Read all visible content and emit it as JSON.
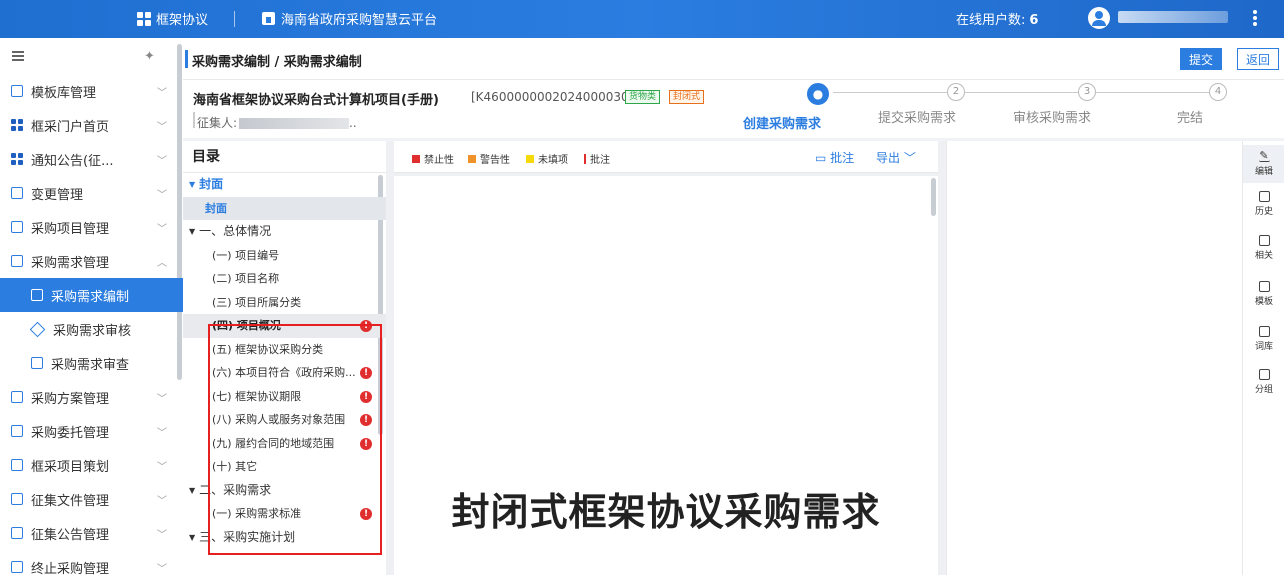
{
  "topbar": {
    "module": "框架协议",
    "platform": "海南省政府采购智慧云平台",
    "online_label": "在线用户数:",
    "online_count": "6"
  },
  "sidebar": {
    "items": [
      {
        "label": "模板库管理",
        "icon": "template-icon"
      },
      {
        "label": "框采门户首页",
        "icon": "grid-icon"
      },
      {
        "label": "通知公告(征...",
        "icon": "grid-icon"
      },
      {
        "label": "变更管理",
        "icon": "change-icon"
      },
      {
        "label": "采购项目管理",
        "icon": "folder-icon"
      },
      {
        "label": "采购需求管理",
        "icon": "document-icon"
      },
      {
        "label": "采购需求编制",
        "icon": "edit-icon"
      },
      {
        "label": "采购需求审核",
        "icon": "diamond-icon"
      },
      {
        "label": "采购需求审查",
        "icon": "review-icon"
      },
      {
        "label": "采购方案管理",
        "icon": "plan-icon"
      },
      {
        "label": "采购委托管理",
        "icon": "entrust-icon"
      },
      {
        "label": "框采项目策划",
        "icon": "folder-icon"
      },
      {
        "label": "征集文件管理",
        "icon": "file-icon"
      },
      {
        "label": "征集公告管理",
        "icon": "notice-icon"
      },
      {
        "label": "终止采购管理",
        "icon": "stop-icon"
      }
    ]
  },
  "breadcrumb": "采购需求编制 / 采购需求编制",
  "actions": {
    "submit": "提交",
    "back": "返回"
  },
  "project": {
    "title": "海南省框架协议采购台式计算机项目(手册)",
    "code": "[K4600000002024000030]",
    "tag_goods": "货物类",
    "tag_closed": "封闭式",
    "collector_label": "征集人:",
    "collector_suffix": ".."
  },
  "steps": [
    {
      "num": "",
      "label": "创建采购需求",
      "active": true
    },
    {
      "num": "2",
      "label": "提交采购需求",
      "active": false
    },
    {
      "num": "3",
      "label": "审核采购需求",
      "active": false
    },
    {
      "num": "4",
      "label": "完结",
      "active": false
    }
  ],
  "toc": {
    "heading": "目录",
    "items": [
      {
        "label": "封面"
      },
      {
        "label": "封面"
      },
      {
        "label": "一、总体情况"
      },
      {
        "label": "(一) 项目编号"
      },
      {
        "label": "(二) 项目名称"
      },
      {
        "label": "(三) 项目所属分类"
      },
      {
        "label": "(四) 项目概况"
      },
      {
        "label": "(五) 框架协议采购分类"
      },
      {
        "label": "(六) 本项目符合《政府采购..."
      },
      {
        "label": "(七) 框架协议期限"
      },
      {
        "label": "(八) 采购人或服务对象范围"
      },
      {
        "label": "(九) 履约合同的地域范围"
      },
      {
        "label": "(十) 其它"
      },
      {
        "label": "二、采购需求"
      },
      {
        "label": "(一) 采购需求标准"
      },
      {
        "label": "三、采购实施计划"
      }
    ]
  },
  "legend": {
    "prohibit": "禁止性",
    "warning": "警告性",
    "unfilled": "未填项",
    "annotation": "批注",
    "colors": {
      "prohibit": "#e02d2d",
      "warning": "#f0922b",
      "unfilled": "#f5d90a"
    }
  },
  "doc_actions": {
    "annotate": "批注",
    "export": "导出"
  },
  "document": {
    "title": "封闭式框架协议采购需求"
  },
  "tools": [
    {
      "label": "编辑",
      "icon": "pencil-icon"
    },
    {
      "label": "历史",
      "icon": "history-icon"
    },
    {
      "label": "相关",
      "icon": "related-icon"
    },
    {
      "label": "模板",
      "icon": "template-icon"
    },
    {
      "label": "词库",
      "icon": "lexicon-icon"
    },
    {
      "label": "分组",
      "icon": "group-icon"
    }
  ]
}
